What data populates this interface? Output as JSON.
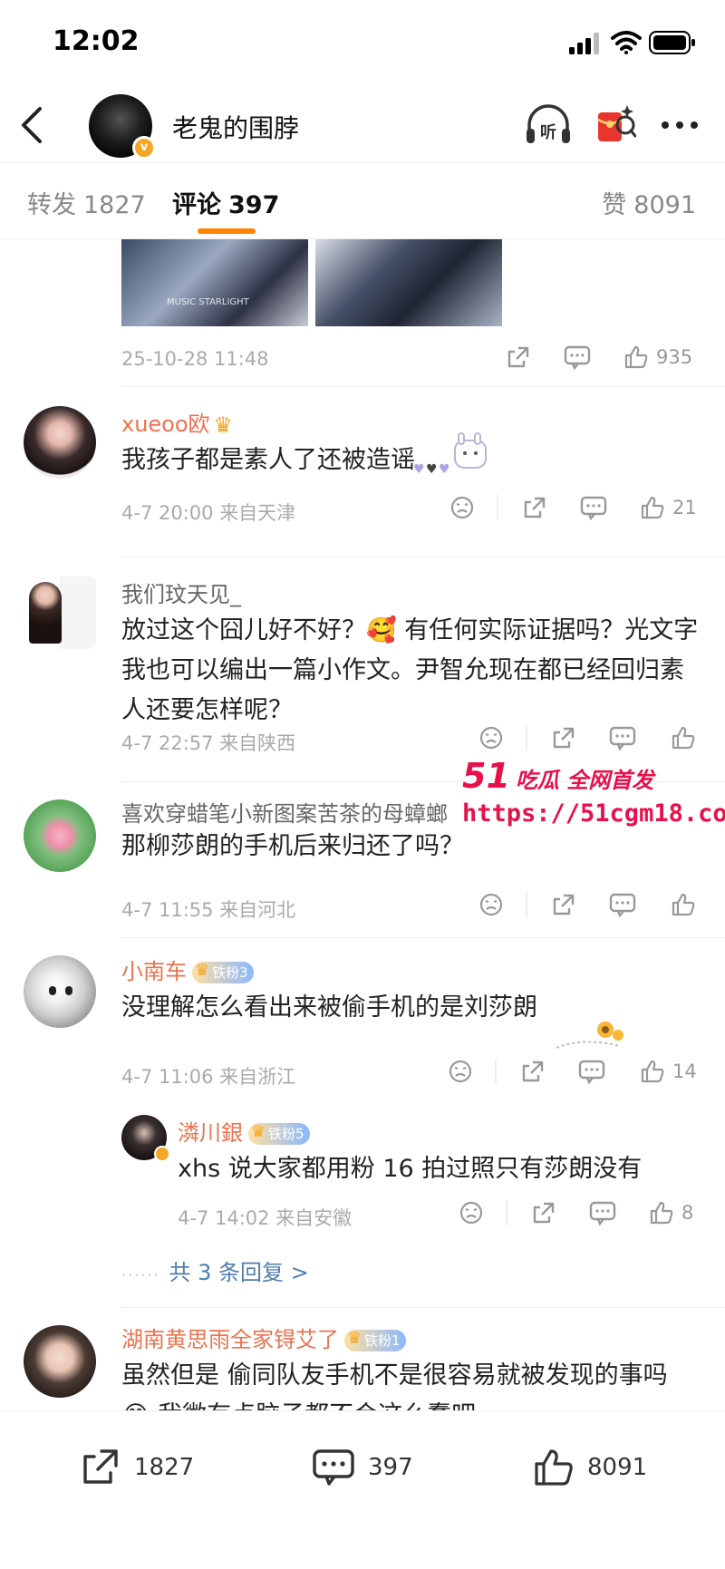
{
  "status": {
    "time": "12:02"
  },
  "header": {
    "title": "老鬼的围脖",
    "back_icon": "chevron-left-icon",
    "listen_label": "听"
  },
  "tabs": {
    "repost": {
      "label": "转发",
      "count": "1827"
    },
    "comment": {
      "label": "评论",
      "count": "397"
    },
    "like": {
      "label": "赞",
      "count": "8091"
    }
  },
  "post": {
    "image_caption": "MUSIC STARLIGHT",
    "date": "25-10-28 11:48",
    "likes": "935"
  },
  "comments": [
    {
      "name": "xueoo欧",
      "text": "我孩子都是素人了还被造谣",
      "meta": "4-7 20:00 来自天津",
      "likes": "21"
    },
    {
      "name": "我们玟天见_",
      "text": "放过这个囧儿好不好？🥰 有任何实际证据吗？光文字我也可以编出一篇小作文。尹智允现在都已经回归素人还要怎样呢？",
      "meta": "4-7 22:57 来自陕西",
      "likes": ""
    },
    {
      "name": "喜欢穿蜡笔小新图案苦茶的母蟑螂",
      "text": "那柳莎朗的手机后来归还了吗？",
      "meta": "4-7 11:55 来自河北",
      "likes": ""
    },
    {
      "name": "小南车",
      "fan": "铁粉3",
      "text": "没理解怎么看出来被偷手机的是刘莎朗",
      "meta": "4-7 11:06 来自浙江",
      "likes": "14"
    },
    {
      "name": "湖南黄思雨全家锝艾了",
      "fan": "铁粉1",
      "text": "虽然但是 偷同队友手机不是很容易就被发现的事吗 😂 我微有点脑子都不会这么蠢吧",
      "meta": "",
      "likes": ""
    }
  ],
  "reply": {
    "name": "潾川銀",
    "fan": "铁粉5",
    "text": "xhs 说大家都用粉 16 拍过照只有莎朗没有",
    "meta": "4-7 14:02 来自安徽",
    "likes": "8"
  },
  "reply_more": "共 3 条回复 >",
  "watermark": {
    "line1_num": "51",
    "line1_text": "吃瓜 全网首发",
    "line2": "https://51cgm18.com"
  },
  "bottom": {
    "share": "1827",
    "comment": "397",
    "like": "8091"
  },
  "colors": {
    "accent": "#ff8200",
    "username": "#eb7350",
    "link": "#507daf",
    "watermark": "#e8104a"
  }
}
